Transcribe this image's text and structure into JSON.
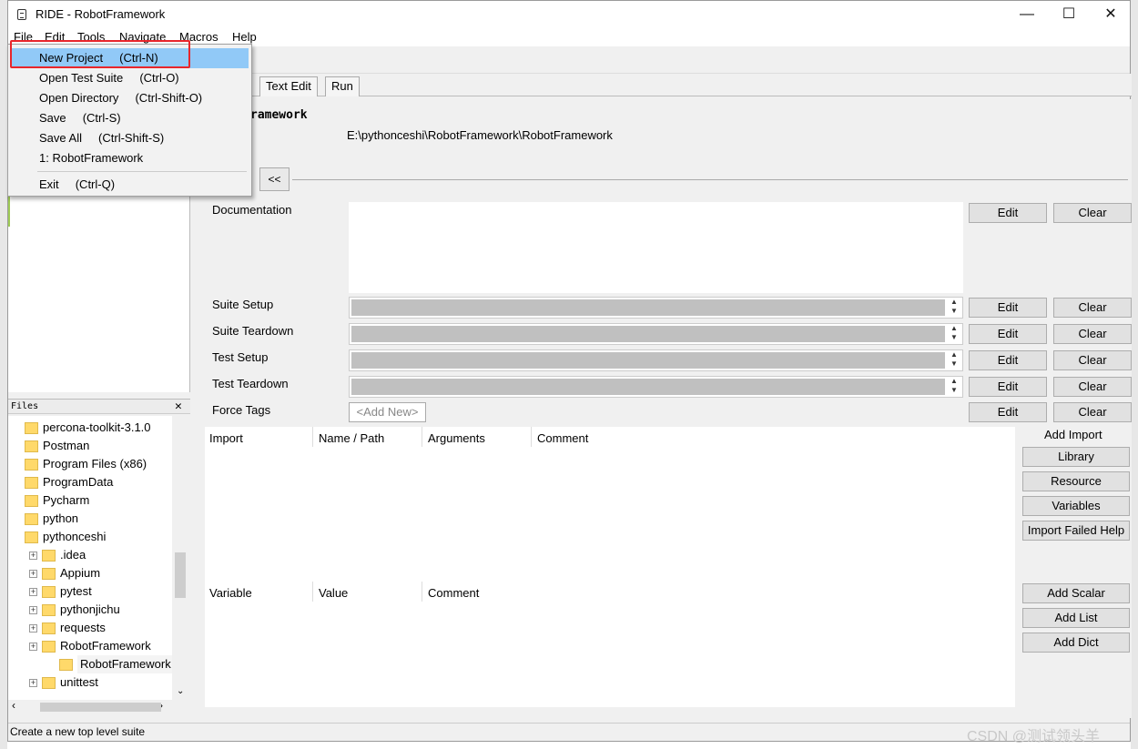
{
  "window": {
    "title": "RIDE - RobotFramework",
    "minimize": "—",
    "maximize": "☐",
    "close": "✕"
  },
  "menubar": {
    "items": [
      "File",
      "Edit",
      "Tools",
      "Navigate",
      "Macros",
      "Help"
    ]
  },
  "file_menu": {
    "items": [
      "New Project     (Ctrl-N)",
      "Open Test Suite     (Ctrl-O)",
      "Open Directory     (Ctrl-Shift-O)",
      "Save     (Ctrl-S)",
      "Save All     (Ctrl-Shift-S)",
      "1: RobotFramework",
      "Exit     (Ctrl-Q)"
    ],
    "highlighted_index": 0
  },
  "tabs": [
    "Text Edit",
    "Run"
  ],
  "suite": {
    "name_partial": "ramework",
    "path": "E:\\pythonceshi\\RobotFramework\\RobotFramework",
    "collapse_label": "<<"
  },
  "settings": {
    "documentation_label": "Documentation",
    "rows": [
      {
        "label": "Suite Setup"
      },
      {
        "label": "Suite Teardown"
      },
      {
        "label": "Test Setup"
      },
      {
        "label": "Test Teardown"
      }
    ],
    "force_tags_label": "Force Tags",
    "force_tags_placeholder": "<Add New>",
    "edit_label": "Edit",
    "clear_label": "Clear"
  },
  "imports": {
    "columns": [
      "Import",
      "Name / Path",
      "Arguments",
      "Comment"
    ],
    "add_label": "Add Import",
    "buttons": [
      "Library",
      "Resource",
      "Variables",
      "Import Failed Help"
    ]
  },
  "variables": {
    "columns": [
      "Variable",
      "Value",
      "Comment"
    ],
    "buttons": [
      "Add Scalar",
      "Add List",
      "Add Dict"
    ]
  },
  "files_panel": {
    "title": "Files",
    "close": "✕",
    "items": [
      {
        "label": "percona-toolkit-3.1.0",
        "level": 0,
        "expander": false
      },
      {
        "label": "Postman",
        "level": 0,
        "expander": false
      },
      {
        "label": "Program Files (x86)",
        "level": 0,
        "expander": false
      },
      {
        "label": "ProgramData",
        "level": 0,
        "expander": false
      },
      {
        "label": "Pycharm",
        "level": 0,
        "expander": false
      },
      {
        "label": "python",
        "level": 0,
        "expander": false
      },
      {
        "label": "pythonceshi",
        "level": 0,
        "expander": false
      },
      {
        "label": ".idea",
        "level": 1,
        "expander": true
      },
      {
        "label": "Appium",
        "level": 1,
        "expander": true
      },
      {
        "label": "pytest",
        "level": 1,
        "expander": true
      },
      {
        "label": "pythonjichu",
        "level": 1,
        "expander": true
      },
      {
        "label": "requests",
        "level": 1,
        "expander": true
      },
      {
        "label": "RobotFramework",
        "level": 1,
        "expander": true
      },
      {
        "label": "RobotFramework",
        "level": 2,
        "expander": false
      },
      {
        "label": "unittest",
        "level": 1,
        "expander": true
      }
    ]
  },
  "statusbar": {
    "text": "Create a new top level suite"
  },
  "watermark": "CSDN @测试领头羊",
  "colors": {
    "highlight": "#91c9f7",
    "annotation_box": "#e8262b",
    "folder": "#ffd96a"
  }
}
